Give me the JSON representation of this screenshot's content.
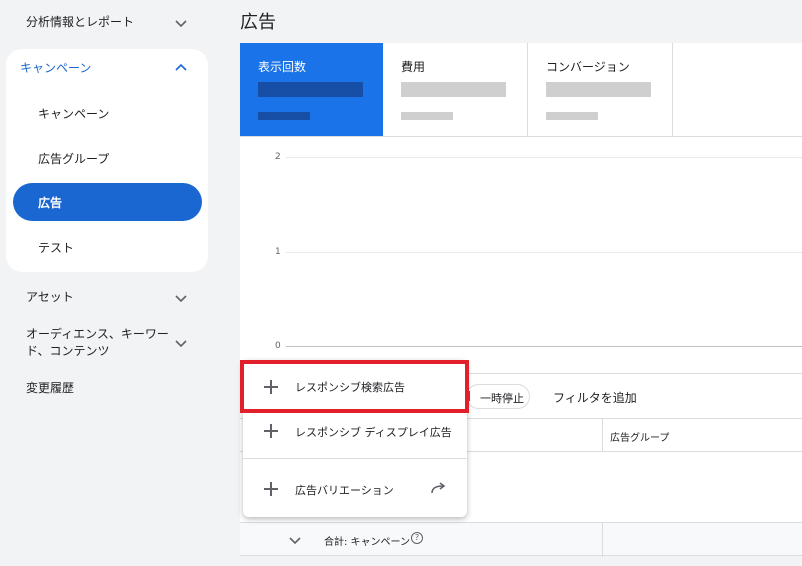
{
  "sidebar": {
    "analytics_label": "分析情報とレポート",
    "campaigns_label": "キャンペーン",
    "sub_items": [
      "キャンペーン",
      "広告グループ",
      "広告",
      "テスト"
    ],
    "assets_label": "アセット",
    "audience_label_line1": "オーディエンス、キーワー",
    "audience_label_line2": "ド、コンテンツ",
    "history_label": "変更履歴"
  },
  "main": {
    "title": "広告",
    "metrics": [
      {
        "label": "表示回数",
        "active": true
      },
      {
        "label": "費用",
        "active": false
      },
      {
        "label": "コンバージョン",
        "active": false
      }
    ],
    "y_ticks": [
      "2",
      "1",
      "0"
    ],
    "pause_chip": "一時停止",
    "add_filter": "フィルタを追加",
    "column_ad_group": "広告グループ",
    "total_label": "合計: キャンペーン",
    "help_glyph": "?"
  },
  "menu": {
    "items": [
      "レスポンシブ検索広告",
      "レスポンシブ ディスプレイ広告",
      "広告バリエーション"
    ]
  },
  "chart_data": {
    "type": "line",
    "title": "",
    "xlabel": "",
    "ylabel": "",
    "y_ticks": [
      0,
      1,
      2
    ],
    "ylim": [
      0,
      2
    ],
    "series": []
  },
  "colors": {
    "accent": "#1a73e8",
    "highlight": "#e2202c"
  }
}
